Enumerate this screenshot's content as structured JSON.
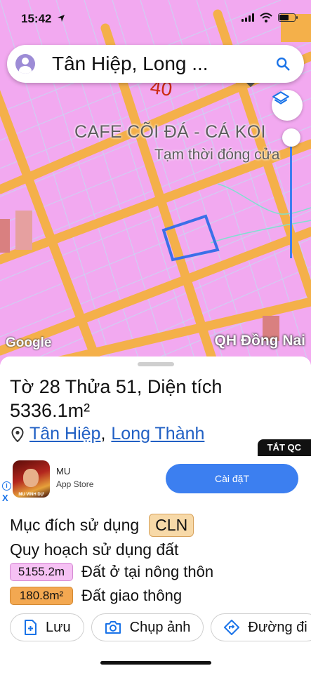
{
  "status_bar": {
    "time": "15:42"
  },
  "search": {
    "query": "Tân Hiệp, Long ..."
  },
  "map": {
    "label_number": "40",
    "poi_name": "CAFE CÕI ĐÁ - CÁ KOI",
    "poi_status": "Tạm thời đóng cửa",
    "logo_text": "Google",
    "overlay_label": "QH Đồng Nai"
  },
  "parcel": {
    "title": "Tờ 28 Thửa 51, Diện tích 5336.1m²",
    "location_commune": "Tân Hiệp",
    "location_separator": ",",
    "location_district": "Long Thành"
  },
  "ad": {
    "hide_ads_label": "TẮT QC",
    "info_glyph": "i",
    "close_glyph": "X",
    "app_caption": "MU VINH DỰ",
    "app_name": "MU",
    "store": "App Store",
    "install_label": "Cài đặT"
  },
  "land_use": {
    "purpose_label": "Mục đích sử dụng",
    "purpose_code": "CLN",
    "planning_label": "Quy hoạch sử dụng đất",
    "planning": [
      {
        "area": "5155.2m",
        "name": "Đất ở tại nông thôn",
        "color": "#f6c1f4"
      },
      {
        "area": "180.8m²",
        "name": "Đất giao thông",
        "color": "#f3a851"
      }
    ]
  },
  "actions": {
    "save_label": "Lưu",
    "photo_label": "Chụp ảnh",
    "directions_label": "Đường đi"
  },
  "colors": {
    "map_pink": "#f2a9f0",
    "road_orange": "#f4b04a",
    "parcel_outline": "#3b6fe8",
    "accent_blue": "#3c7ff0",
    "link_blue": "#2160c4"
  },
  "icons": [
    "location-arrow-icon",
    "signal-icon",
    "wifi-icon",
    "battery-icon",
    "avatar-icon",
    "search-icon",
    "layers-icon",
    "pin-icon",
    "add-bookmark-icon",
    "camera-icon",
    "directions-icon"
  ]
}
